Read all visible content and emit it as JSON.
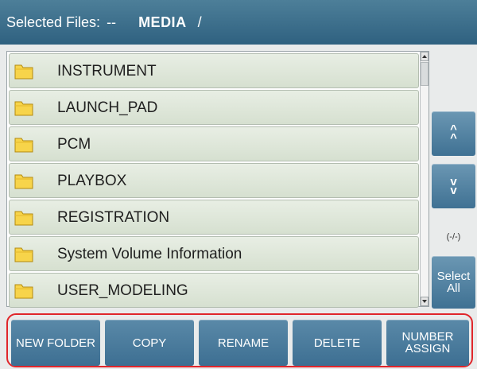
{
  "header": {
    "selected_label": "Selected Files:",
    "selected_value": "--",
    "path_name": "MEDIA",
    "path_separator": "/"
  },
  "files": [
    {
      "name": "INSTRUMENT",
      "icon": "folder-icon"
    },
    {
      "name": "LAUNCH_PAD",
      "icon": "folder-icon"
    },
    {
      "name": "PCM",
      "icon": "folder-icon"
    },
    {
      "name": "PLAYBOX",
      "icon": "folder-icon"
    },
    {
      "name": "REGISTRATION",
      "icon": "folder-icon"
    },
    {
      "name": "System Volume Information",
      "icon": "folder-icon"
    },
    {
      "name": "USER_MODELING",
      "icon": "folder-icon"
    }
  ],
  "side": {
    "up_label": "^\n^",
    "down_label": "v\nv",
    "counter": "(-/-)",
    "select_all_line1": "Select",
    "select_all_line2": "All"
  },
  "toolbar": {
    "new_folder": "NEW FOLDER",
    "copy": "COPY",
    "rename": "RENAME",
    "delete": "DELETE",
    "number_assign_line1": "NUMBER",
    "number_assign_line2": "ASSIGN"
  },
  "colors": {
    "header": "#2f6180",
    "button": "#4b7c9c",
    "row": "#dfe6da",
    "highlight_outline": "#e0262b",
    "folder": "#f7d44a"
  }
}
